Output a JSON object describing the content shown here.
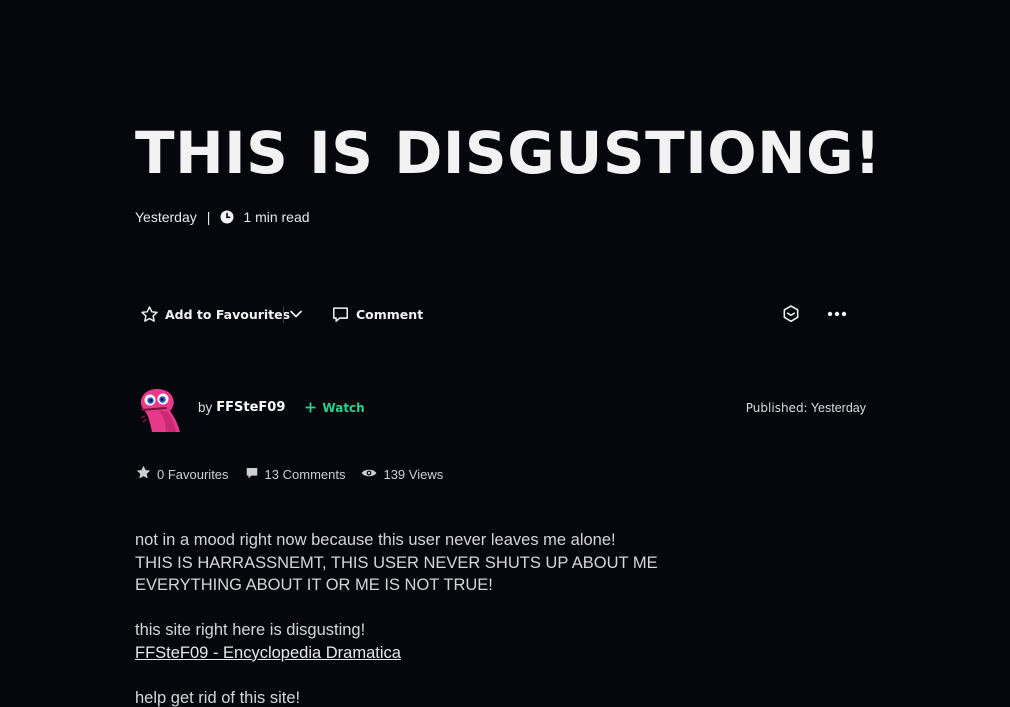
{
  "post": {
    "title": "THIS IS DISGUSTIONG!",
    "date": "Yesterday",
    "read_time": "1 min read"
  },
  "actions": {
    "favourite_label": "Add to Favourites",
    "comment_label": "Comment"
  },
  "author": {
    "by_prefix": "by",
    "name": "FFSteF09",
    "watch_label": "Watch"
  },
  "published": {
    "label": "Published:",
    "value": "Yesterday"
  },
  "stats": {
    "favourites": "0 Favourites",
    "comments": "13 Comments",
    "views": "139 Views"
  },
  "body": {
    "line1": "not in a mood right now because this user never leaves me alone!",
    "line2": "THIS IS HARRASSNEMT, THIS USER NEVER SHUTS UP ABOUT ME",
    "line3": "EVERYTHING ABOUT IT OR ME IS NOT TRUE!",
    "line4": "this site right here is disgusting!",
    "link": "FFSteF09 - Encyclopedia Dramatica",
    "line5": "help get rid of this site!"
  },
  "colors": {
    "background": "#06070d",
    "watch_accent": "#2ed08e"
  },
  "icons": [
    "clock-icon",
    "star-outline-icon",
    "chevron-down-icon",
    "comment-icon",
    "share-icon",
    "more-icon",
    "plus-icon",
    "star-filled-icon",
    "comment-filled-icon",
    "eye-icon"
  ]
}
